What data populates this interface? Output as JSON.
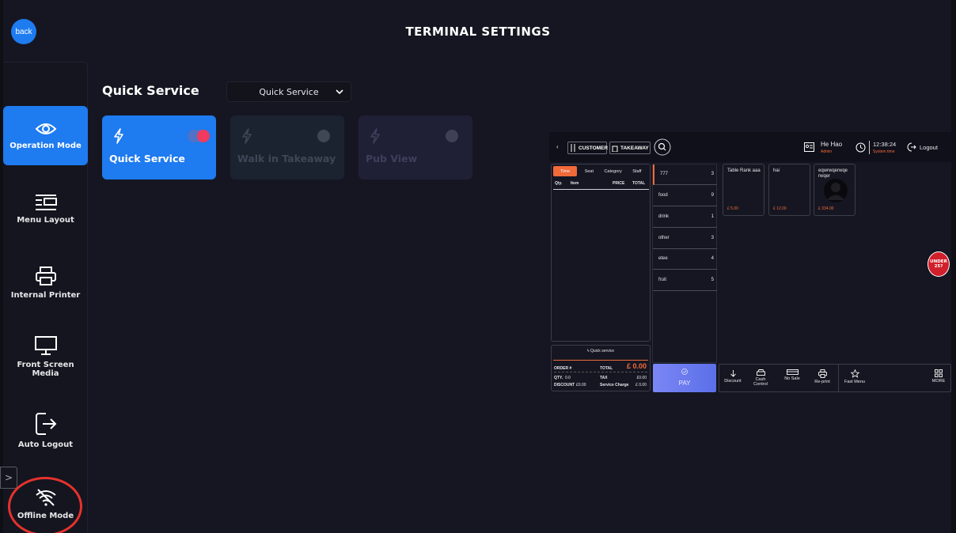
{
  "header": {
    "back_label": "back",
    "title": "TERMINAL SETTINGS"
  },
  "sidebar": {
    "items": [
      {
        "label": "Operation Mode",
        "icon": "eye-icon",
        "active": true
      },
      {
        "label": "Menu Layout",
        "icon": "layout-icon",
        "active": false
      },
      {
        "label": "Internal Printer",
        "icon": "printer-icon",
        "active": false
      },
      {
        "label": "Front Screen Media",
        "icon": "monitor-icon",
        "active": false
      },
      {
        "label": "Auto Logout",
        "icon": "logout-icon",
        "active": false
      },
      {
        "label": "Offline Mode",
        "icon": "wifi-off-icon",
        "active": false
      }
    ],
    "collapse_symbol": ">"
  },
  "main": {
    "section_title": "Quick Service",
    "mode_select": {
      "value": "Quick Service"
    },
    "mode_cards": [
      {
        "label": "Quick Service",
        "enabled": true
      },
      {
        "label": "Walk in Takeaway",
        "enabled": false
      },
      {
        "label": "Pub View",
        "enabled": false
      }
    ]
  },
  "preview": {
    "topbar": {
      "back_symbol": "‹",
      "customer_label": "CUSTOMER",
      "takeaway_label": "TAKEAWAY",
      "user_name": "He Hao",
      "user_role": "Admin",
      "time": "12:38:24",
      "time_label": "System time",
      "logout_label": "Logout"
    },
    "order_tabs": [
      "Time",
      "Seat",
      "Category",
      "Staff"
    ],
    "order_columns": {
      "qty": "Qty.",
      "item": "Item",
      "price": "PRICE",
      "total": "TOTAL"
    },
    "categories": [
      {
        "name": "777",
        "count": "3"
      },
      {
        "name": "food",
        "count": "9"
      },
      {
        "name": "drink",
        "count": "1"
      },
      {
        "name": "other",
        "count": "3"
      },
      {
        "name": "etee",
        "count": "4"
      },
      {
        "name": "fruit",
        "count": "5"
      }
    ],
    "products": [
      {
        "name": "Table Rank aaa",
        "price": "£ 5.00"
      },
      {
        "name": "hai",
        "price": "£ 12.00"
      },
      {
        "name": "eqwrwqerwqe rwqer",
        "price": "£ 334.00"
      }
    ],
    "summary": {
      "mode_label": "Quick service",
      "order_label": "ORDER #",
      "total_label": "TOTAL",
      "total_value": "£ 0.00",
      "qty_label": "QTY.",
      "qty_value": "0.0",
      "tax_label": "TAX",
      "tax_value": "£0.00",
      "discount_label": "DISCOUNT",
      "discount_value": "£0.00",
      "service_label": "Service Charge",
      "service_value": "£ 0.00"
    },
    "pay_label": "PAY",
    "actions": [
      "Discount",
      "Cash Control",
      "No Sale",
      "Re-print",
      "Fast Menu",
      "MORE"
    ]
  },
  "badge": {
    "line1": "UNDER",
    "line2": "25?"
  },
  "colors": {
    "accent": "#1e7bf0",
    "background": "#161622",
    "toggle_on": "#f03a5f",
    "highlight": "#f06a3a",
    "annotation_circle": "#e5322d"
  }
}
